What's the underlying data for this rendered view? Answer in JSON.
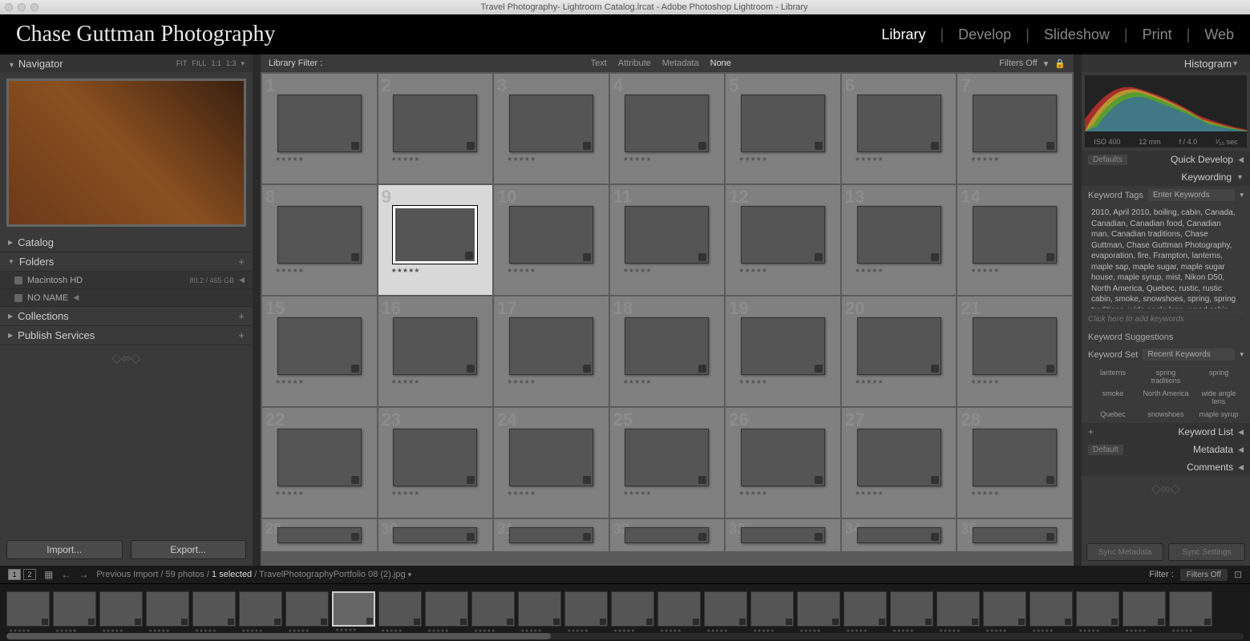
{
  "titlebar": "Travel Photography- Lightroom Catalog.lrcat - Adobe Photoshop Lightroom - Library",
  "brand": "Chase Guttman Photography",
  "modules": {
    "library": "Library",
    "develop": "Develop",
    "slideshow": "Slideshow",
    "print": "Print",
    "web": "Web"
  },
  "left": {
    "navigator": "Navigator",
    "nav_opts": {
      "fit": "FIT",
      "fill": "FILL",
      "one": "1:1",
      "ratio": "1:3"
    },
    "catalog": "Catalog",
    "folders": "Folders",
    "disk1": {
      "name": "Macintosh HD",
      "size": "80.2 / 465 GB"
    },
    "disk2": {
      "name": "NO NAME"
    },
    "collections": "Collections",
    "publish": "Publish Services",
    "import": "Import...",
    "export": "Export..."
  },
  "filterbar": {
    "label": "Library Filter :",
    "text": "Text",
    "attribute": "Attribute",
    "metadata": "Metadata",
    "none": "None",
    "filters_off": "Filters Off"
  },
  "grid": {
    "stars": "★★★★★",
    "count": 35,
    "selected_index": 9,
    "colors": [
      "c-warm",
      "c-sand",
      "c-warm",
      "c-dark",
      "c-warm",
      "c-teal",
      "c-teal",
      "c-dark",
      "c-dark",
      "c-warm",
      "c-green",
      "c-red",
      "c-blue",
      "c-green",
      "c-bw",
      "c-warm",
      "c-dark",
      "c-sand",
      "c-pink",
      "c-warm",
      "c-warm",
      "c-teal",
      "c-red",
      "c-green",
      "c-warm",
      "c-snow",
      "c-snow",
      "c-purple",
      "c-dark",
      "c-dark",
      "c-dark",
      "c-dark",
      "c-dark",
      "c-dark",
      "c-dark"
    ]
  },
  "right": {
    "histogram": "Histogram",
    "histo_meta": {
      "iso": "ISO 400",
      "focal": "12 mm",
      "aperture": "f / 4.0",
      "shutter": "¹⁄₁₅ sec"
    },
    "defaults": "Defaults",
    "quickdev": "Quick Develop",
    "keywording": "Keywording",
    "keyword_tags": "Keyword Tags",
    "enter_keywords": "Enter Keywords",
    "keywords_text": "2010, April 2010, boiling, cabin, Canada, Canadian, Canadian food, Canadian man, Canadian traditions, Chase Guttman, Chase Guttman Photography, evaporation, fire, Frampton, lanterns, maple sap, maple sugar, maple sugar house, maple syrup, mist, Nikon D50, North America, Quebec, rustic, rustic cabin, smoke, snowshoes, spring, spring traditions, wide angle lens, wood cabin,",
    "add_keywords": "Click here to add keywords",
    "keyword_suggestions": "Keyword Suggestions",
    "keyword_set": "Keyword Set",
    "recent_keywords": "Recent Keywords",
    "kw_grid": [
      "lanterns",
      "spring traditions",
      "spring",
      "smoke",
      "North America",
      "wide angle lens",
      "Quebec",
      "snowshoes",
      "maple syrup"
    ],
    "keyword_list": "Keyword List",
    "metadata": "Metadata",
    "default": "Default",
    "comments": "Comments",
    "sync_metadata": "Sync Metadata",
    "sync_settings": "Sync Settings"
  },
  "toolbar": {
    "view1": "1",
    "view2": "2",
    "path_prefix": "Previous Import / 59 photos / ",
    "path_selected": "1 selected",
    "path_suffix": " / TravelPhotographyPortfolio 08 (2).jpg",
    "filter": "Filter :",
    "filters_off": "Filters Off"
  },
  "filmstrip": {
    "stars": "★★★★★",
    "count": 26,
    "selected_index": 8,
    "colors": [
      "c-warm",
      "c-sand",
      "c-warm",
      "c-dark",
      "c-warm",
      "c-teal",
      "c-teal",
      "c-dark",
      "c-dark",
      "c-warm",
      "c-green",
      "c-blue",
      "c-blue",
      "c-green",
      "c-bw",
      "c-warm",
      "c-dark",
      "c-sand",
      "c-pink",
      "c-warm",
      "c-warm",
      "c-teal",
      "c-red",
      "c-green",
      "c-warm",
      "c-sand"
    ]
  }
}
